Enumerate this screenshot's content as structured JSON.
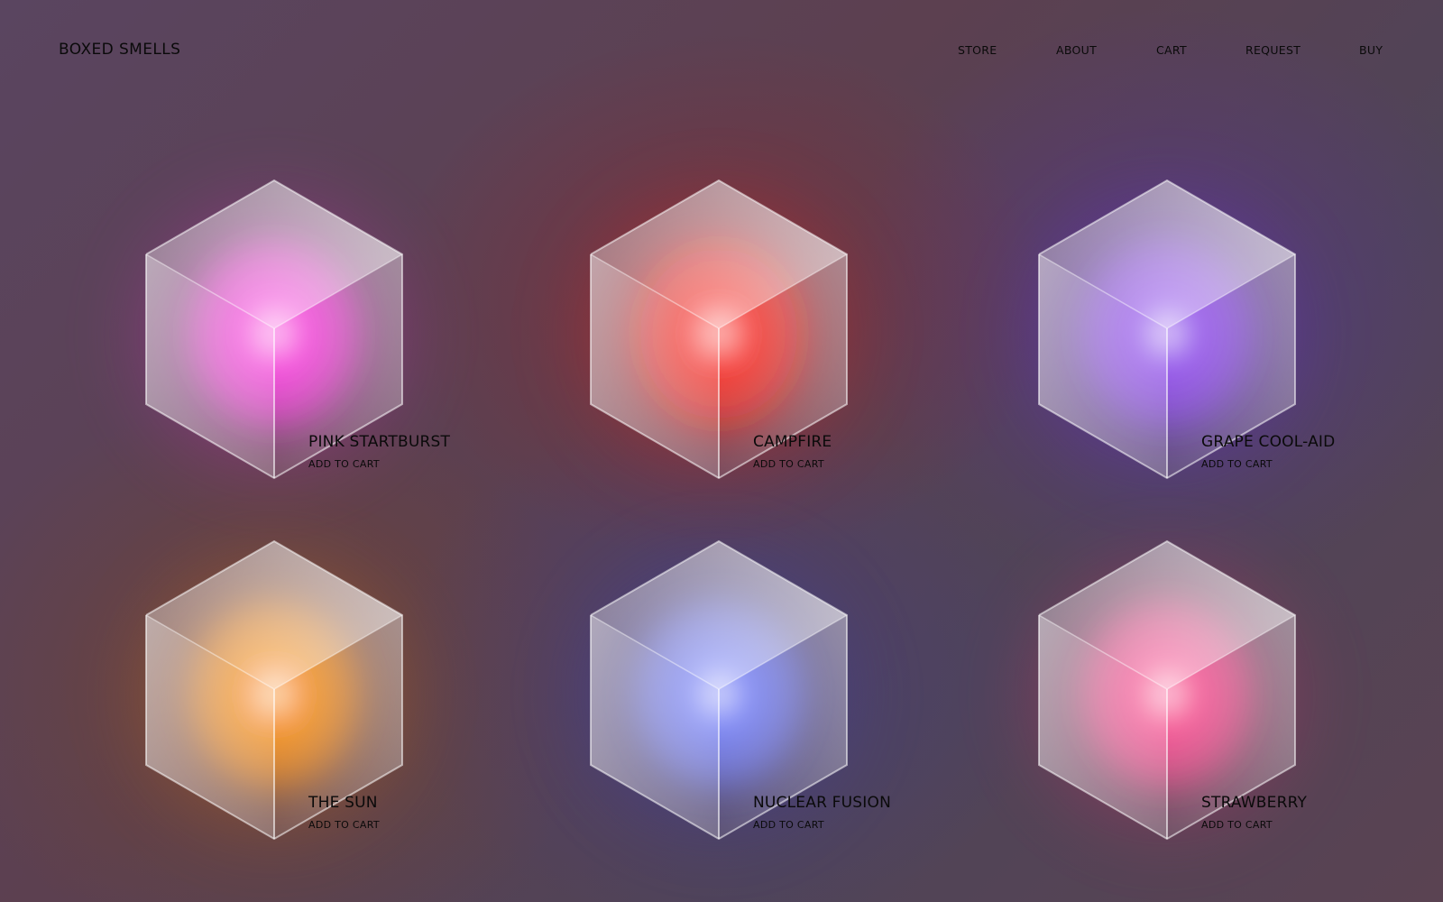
{
  "brand": "BOXED SMELLS",
  "nav": {
    "store": "STORE",
    "about": "ABOUT",
    "cart": "CART",
    "request": "REQUEST",
    "buy": "BUY"
  },
  "products": [
    {
      "name": "PINK STARTBURST",
      "action": "ADD TO CART",
      "color": "#ff2fe0",
      "glow": "#d02ab8"
    },
    {
      "name": "CAMPFIRE",
      "action": "ADD TO CART",
      "color": "#ff1a10",
      "glow": "#e0251f"
    },
    {
      "name": "GRAPE COOL-AID",
      "action": "ADD TO CART",
      "color": "#8a3cf0",
      "glow": "#6a2fd8"
    },
    {
      "name": "THE SUN",
      "action": "ADD TO CART",
      "color": "#ff8a00",
      "glow": "#c86a20"
    },
    {
      "name": "NUCLEAR FUSION",
      "action": "ADD TO CART",
      "color": "#6a78ff",
      "glow": "#3c3ea8"
    },
    {
      "name": "STRAWBERRY",
      "action": "ADD TO CART",
      "color": "#ff3e8a",
      "glow": "#d82a6a"
    }
  ],
  "theme": {
    "text": "#0a0a0a"
  }
}
